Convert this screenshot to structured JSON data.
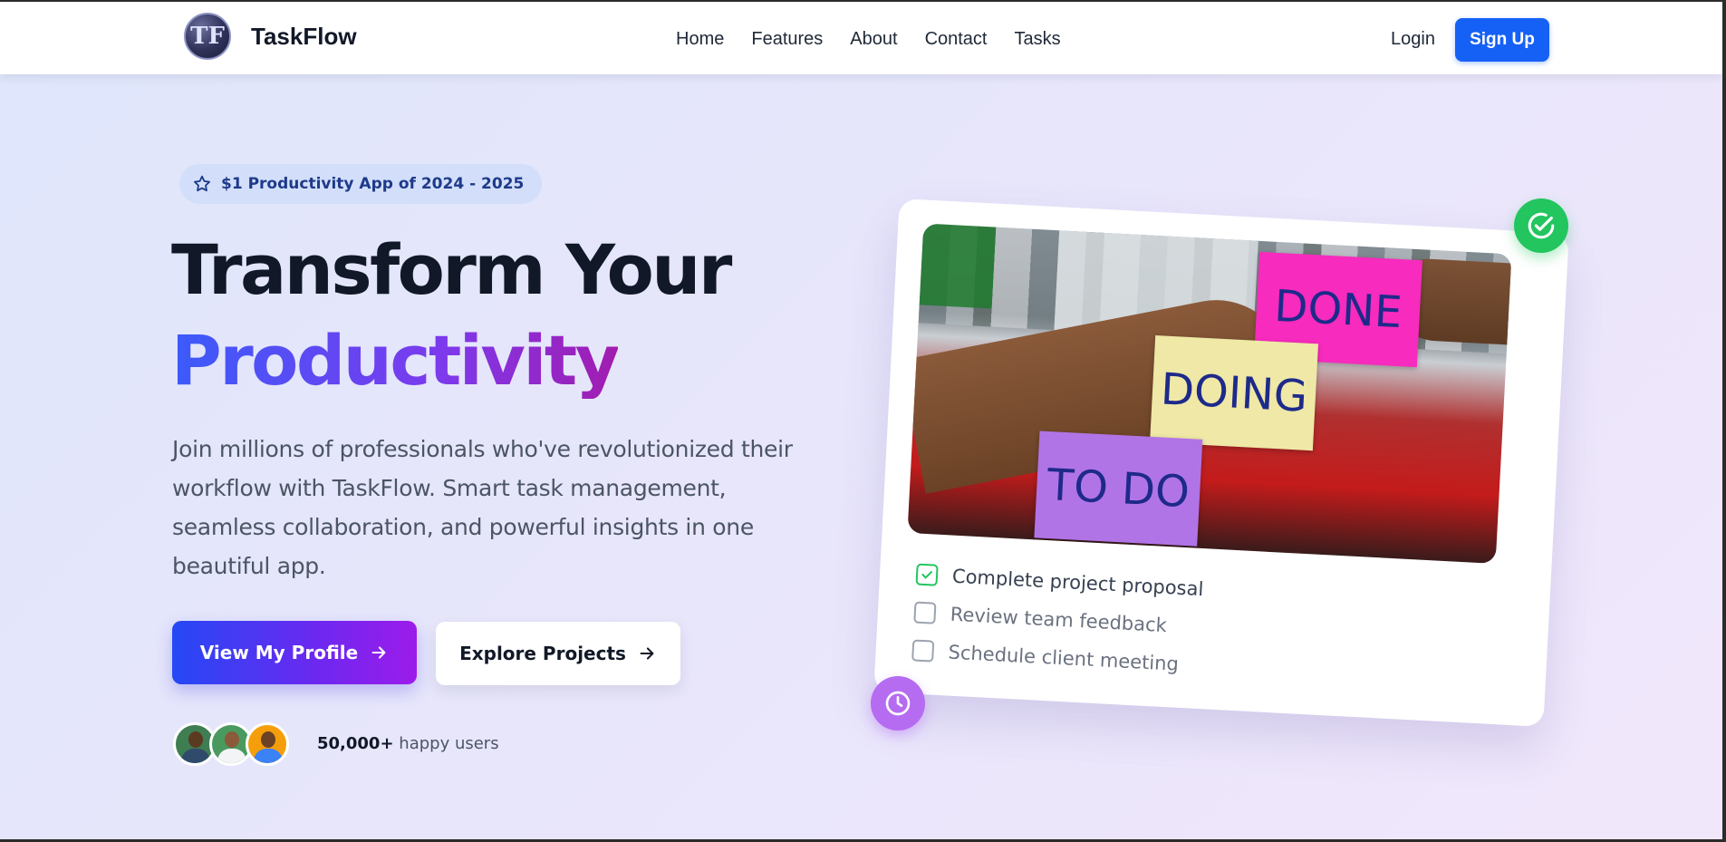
{
  "brand": {
    "logo_initials": "TF",
    "name": "TaskFlow"
  },
  "nav": {
    "links": [
      "Home",
      "Features",
      "About",
      "Contact",
      "Tasks"
    ],
    "login": "Login",
    "signup": "Sign Up"
  },
  "hero": {
    "badge": "$1 Productivity App of 2024 - 2025",
    "title_line1": "Transform Your",
    "title_line2": "Productivity",
    "description": "Join millions of professionals who've revolutionized their workflow with TaskFlow. Smart task management, seamless collaboration, and powerful insights in one beautiful app.",
    "primary_button": "View My Profile",
    "secondary_button": "Explore Projects",
    "users_count": "50,000+",
    "users_label": "happy users"
  },
  "card": {
    "stickies": {
      "done": "DONE",
      "doing": "DOING",
      "todo": "TO DO"
    },
    "tasks": [
      {
        "label": "Complete project proposal",
        "checked": true
      },
      {
        "label": "Review team feedback",
        "checked": false
      },
      {
        "label": "Schedule client meeting",
        "checked": false
      }
    ]
  },
  "icons": {
    "badge": "star-icon",
    "primary_button": "arrow-right-icon",
    "secondary_button": "arrow-right-icon",
    "float_top": "check-circle-icon",
    "float_bottom": "clock-icon"
  },
  "colors": {
    "accent": "#1661f5",
    "gradient_start": "#2548f5",
    "gradient_end": "#9d1bea",
    "success": "#22c55e",
    "purple": "#b56cf0"
  }
}
